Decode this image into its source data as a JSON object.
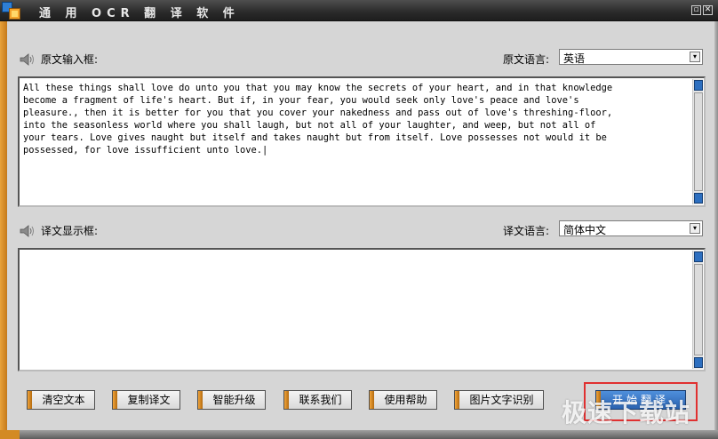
{
  "window": {
    "title": "通 用 OCR 翻 译 软 件",
    "minimize": "▫",
    "close": "✕"
  },
  "source": {
    "label": "原文输入框:",
    "lang_label": "原文语言:",
    "lang_value": "英语",
    "text": "All these things shall love do unto you that you may know the secrets of your heart, and in that knowledge\nbecome a fragment of life's heart. But if, in your fear, you would seek only love's peace and love's\npleasure., then it is better for you that you cover your nakedness and pass out of love's threshing-floor,\ninto the seasonless world where you shall laugh, but not all of your laughter, and weep, but not all of\nyour tears. Love gives naught but itself and takes naught but from itself. Love possesses not would it be\npossessed, for love issufficient unto love.|"
  },
  "target": {
    "label": "译文显示框:",
    "lang_label": "译文语言:",
    "lang_value": "简体中文",
    "text": ""
  },
  "buttons": {
    "clear": "清空文本",
    "copy": "复制译文",
    "upgrade": "智能升级",
    "contact": "联系我们",
    "help": "使用帮助",
    "ocr": "图片文字识别",
    "translate": "开始翻译"
  },
  "watermark": "极速下载站",
  "icons": {
    "speaker": "speaker-icon",
    "dropdown": "dropdown-arrow-icon"
  },
  "colors": {
    "accent_orange": "#e9a23a",
    "primary_blue": "#2b63b0",
    "highlight_red": "#e03030"
  }
}
